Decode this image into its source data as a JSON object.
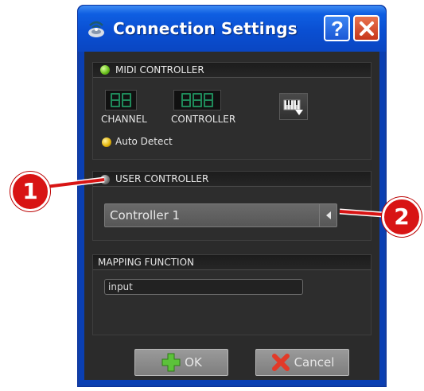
{
  "window": {
    "title": "Connection Settings",
    "help_icon": "help-icon",
    "close_icon": "close-icon"
  },
  "midi_panel": {
    "title": "MIDI CONTROLLER",
    "led_color": "#6cc21e",
    "channel_label": "CHANNEL",
    "controller_label": "CONTROLLER",
    "channel_digits": 2,
    "controller_digits": 3,
    "auto_detect_label": "Auto Detect",
    "keyboard_button_icon": "midi-keyboard-icon"
  },
  "user_panel": {
    "title": "USER CONTROLLER",
    "selected_controller": "Controller 1",
    "arrow_icon": "triangle-left-icon"
  },
  "mapping_panel": {
    "title": "MAPPING FUNCTION",
    "input_value": "input"
  },
  "buttons": {
    "ok_label": "OK",
    "ok_icon": "green-plus-icon",
    "cancel_label": "Cancel",
    "cancel_icon": "red-x-icon"
  },
  "callouts": {
    "one": "1",
    "two": "2"
  },
  "colors": {
    "titlebar": "#0a4fd2",
    "client_bg": "#2b2b2b",
    "callout": "#d81414"
  }
}
